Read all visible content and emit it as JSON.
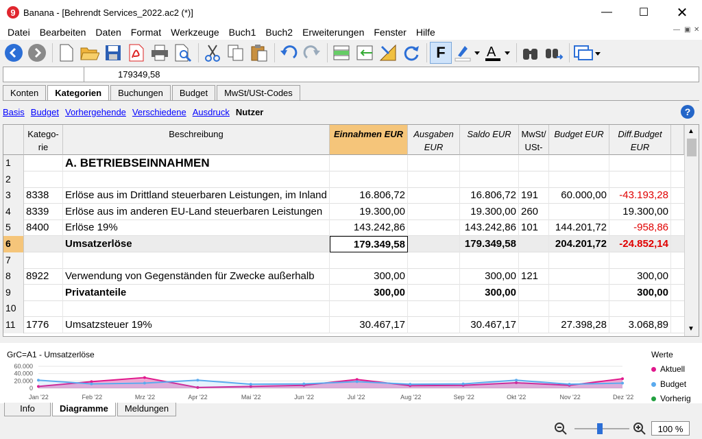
{
  "window": {
    "title": "Banana - [Behrendt Services_2022.ac2 (*)]",
    "logo": "9"
  },
  "menu": [
    "Datei",
    "Bearbeiten",
    "Daten",
    "Format",
    "Werkzeuge",
    "Buch1",
    "Buch2",
    "Erweiterungen",
    "Fenster",
    "Hilfe"
  ],
  "formula": {
    "cell_ref": "",
    "value": "179349,58"
  },
  "tabs": [
    "Konten",
    "Kategorien",
    "Buchungen",
    "Budget",
    "MwSt/USt-Codes"
  ],
  "active_tab": "Kategorien",
  "views": [
    "Basis",
    "Budget",
    "Vorhergehende",
    "Verschiedene",
    "Ausdruck",
    "Nutzer"
  ],
  "active_view": "Nutzer",
  "columns": {
    "rn": "",
    "kat": "Katego-rie",
    "beschr": "Beschreibung",
    "ein": "Einnahmen EUR",
    "aus": "Ausgaben EUR",
    "saldo": "Saldo EUR",
    "mwst": "MwSt/ USt-",
    "budget": "Budget EUR",
    "diff": "Diff.Budget EUR"
  },
  "rows": [
    {
      "n": "1",
      "kat": "",
      "beschr": "A. BETRIEBSEINNAHMEN",
      "ein": "",
      "aus": "",
      "saldo": "",
      "mwst": "",
      "budget": "",
      "diff": ""
    },
    {
      "n": "2",
      "kat": "",
      "beschr": "",
      "ein": "",
      "aus": "",
      "saldo": "",
      "mwst": "",
      "budget": "",
      "diff": ""
    },
    {
      "n": "3",
      "kat": "8338",
      "beschr": "Erlöse aus im Drittland steuerbaren Leistungen, im Inland",
      "ein": "16.806,72",
      "aus": "",
      "saldo": "16.806,72",
      "mwst": "191",
      "budget": "60.000,00",
      "diff": "-43.193,28"
    },
    {
      "n": "4",
      "kat": "8339",
      "beschr": "Erlöse aus im anderen EU-Land steuerbaren Leistungen",
      "ein": "19.300,00",
      "aus": "",
      "saldo": "19.300,00",
      "mwst": "260",
      "budget": "",
      "diff": "19.300,00"
    },
    {
      "n": "5",
      "kat": "8400",
      "beschr": "Erlöse 19%",
      "ein": "143.242,86",
      "aus": "",
      "saldo": "143.242,86",
      "mwst": "101",
      "budget": "144.201,72",
      "diff": "-958,86"
    },
    {
      "n": "6",
      "kat": "",
      "beschr": "Umsatzerlöse",
      "ein": "179.349,58",
      "aus": "",
      "saldo": "179.349,58",
      "mwst": "",
      "budget": "204.201,72",
      "diff": "-24.852,14"
    },
    {
      "n": "7",
      "kat": "",
      "beschr": "",
      "ein": "",
      "aus": "",
      "saldo": "",
      "mwst": "",
      "budget": "",
      "diff": ""
    },
    {
      "n": "8",
      "kat": "8922",
      "beschr": "Verwendung von Gegenständen für Zwecke außerhalb",
      "ein": "300,00",
      "aus": "",
      "saldo": "300,00",
      "mwst": "121",
      "budget": "",
      "diff": "300,00"
    },
    {
      "n": "9",
      "kat": "",
      "beschr": "Privatanteile",
      "ein": "300,00",
      "aus": "",
      "saldo": "300,00",
      "mwst": "",
      "budget": "",
      "diff": "300,00"
    },
    {
      "n": "10",
      "kat": "",
      "beschr": "",
      "ein": "",
      "aus": "",
      "saldo": "",
      "mwst": "",
      "budget": "",
      "diff": ""
    },
    {
      "n": "11",
      "kat": "1776",
      "beschr": "Umsatzsteuer 19%",
      "ein": "30.467,17",
      "aus": "",
      "saldo": "30.467,17",
      "mwst": "",
      "budget": "27.398,28",
      "diff": "3.068,89"
    }
  ],
  "chart_data": {
    "type": "area",
    "title": "GrC=A1 - Umsatzerlöse",
    "categories": [
      "Jan '22",
      "Feb '22",
      "Mrz '22",
      "Apr '22",
      "Mai '22",
      "Jun '22",
      "Jul '22",
      "Aug '22",
      "Sep '22",
      "Okt '22",
      "Nov '22",
      "Dez '22"
    ],
    "yticks": [
      "60.000",
      "40.000",
      "20.000",
      "0"
    ],
    "ylim": [
      0,
      60000
    ],
    "legend_title": "Werte",
    "series": [
      {
        "name": "Aktuell",
        "color": "#e0188c",
        "values": [
          5000,
          18000,
          29000,
          2000,
          5000,
          8000,
          24000,
          7000,
          8000,
          15000,
          8000,
          26000
        ]
      },
      {
        "name": "Budget",
        "color": "#5aaaee",
        "values": [
          22000,
          12000,
          14000,
          22000,
          11000,
          12000,
          18000,
          11000,
          12000,
          22000,
          11000,
          14000
        ]
      },
      {
        "name": "Vorherig",
        "color": "#22a040",
        "values": []
      }
    ]
  },
  "bottom_tabs": [
    "Info",
    "Diagramme",
    "Meldungen"
  ],
  "active_bottom_tab": "Diagramme",
  "zoom": "100 %"
}
